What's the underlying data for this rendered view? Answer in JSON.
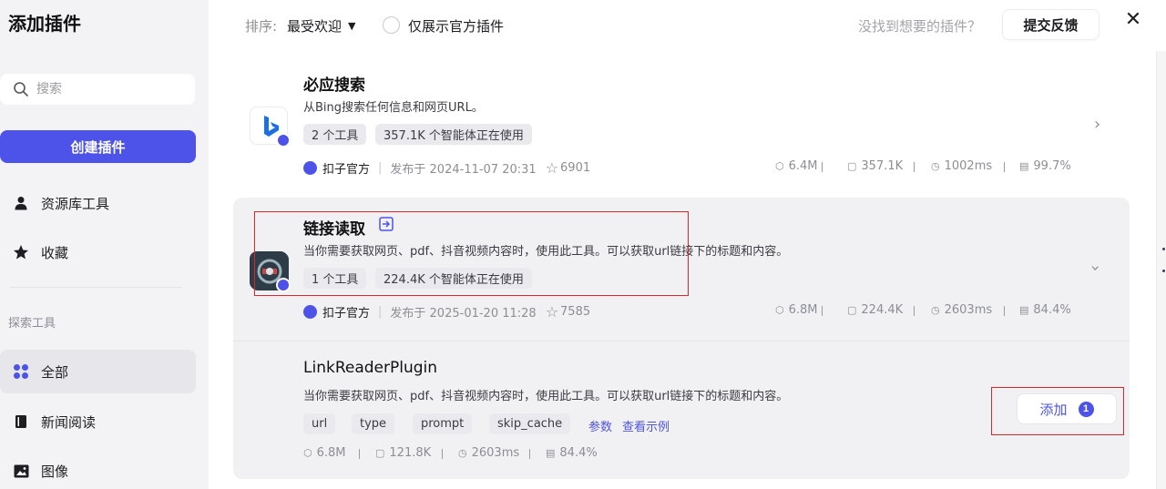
{
  "sidebar": {
    "title": "添加插件",
    "search_placeholder": "搜索",
    "create_button": "创建插件",
    "items": [
      {
        "label": "资源库工具",
        "icon": "user-icon"
      },
      {
        "label": "收藏",
        "icon": "star-icon"
      }
    ],
    "explore_label": "探索工具",
    "categories": [
      {
        "label": "全部",
        "icon": "grid-icon",
        "active": true
      },
      {
        "label": "新闻阅读",
        "icon": "book-icon"
      },
      {
        "label": "图像",
        "icon": "image-icon"
      }
    ]
  },
  "topbar": {
    "sort_label": "排序:",
    "sort_value": "最受欢迎",
    "official_only_label": "仅展示官方插件",
    "not_found_text": "没找到想要的插件？",
    "feedback_button": "提交反馈",
    "close_icon": "close-icon"
  },
  "plugins": [
    {
      "name": "必应搜索",
      "description": "从Bing搜索任何信息和网页URL。",
      "tags": [
        "2 个工具",
        "357.1K 个智能体正在使用"
      ],
      "publisher": "扣子官方",
      "published": "发布于 2024-11-07 20:31",
      "stars": "6901",
      "stats": [
        "6.4M",
        "357.1K",
        "1002ms",
        "99.7%"
      ]
    },
    {
      "name": "链接读取",
      "description": "当你需要获取网页、pdf、抖音视频内容时，使用此工具。可以获取url链接下的标题和内容。",
      "tags": [
        "1 个工具",
        "224.4K 个智能体正在使用"
      ],
      "publisher": "扣子官方",
      "published": "发布于 2025-01-20 11:28",
      "stars": "7585",
      "stats": [
        "6.8M",
        "224.4K",
        "2603ms",
        "84.4%"
      ],
      "tool": {
        "name": "LinkReaderPlugin",
        "description": "当你需要获取网页、pdf、抖音视频内容时，使用此工具。可以获取url链接下的标题和内容。",
        "params": [
          "url",
          "type",
          "prompt",
          "skip_cache"
        ],
        "params_link": "参数",
        "example_link": "查看示例",
        "stats": [
          "6.8M",
          "121.8K",
          "2603ms",
          "84.4%"
        ],
        "add_button": "添加",
        "add_count": "1"
      }
    }
  ],
  "colors": {
    "accent": "#4d53e8",
    "highlight_box": "#d9272e"
  }
}
